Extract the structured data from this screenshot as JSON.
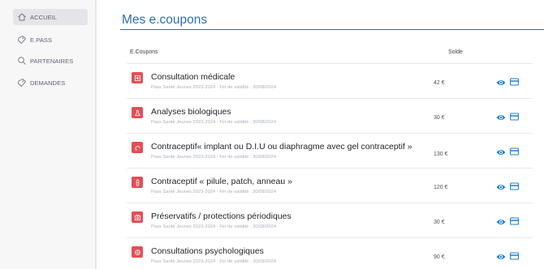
{
  "sidebar": {
    "items": [
      {
        "label": "ACCUEIL",
        "icon": "home-icon",
        "active": true
      },
      {
        "label": "E.PASS",
        "icon": "ticket-icon",
        "active": false
      },
      {
        "label": "PARTENAIRES",
        "icon": "search-icon",
        "active": false
      },
      {
        "label": "DEMANDES",
        "icon": "ticket-icon",
        "active": false
      }
    ]
  },
  "main": {
    "title": "Mes e.coupons",
    "columns": {
      "coupons": "E.Coupons",
      "solde": "Solde"
    },
    "rows": [
      {
        "name": "Consultation médicale",
        "sub": "Pass Santé Jeunes 2023-2024 - Fin de validité : 30/08/2024",
        "solde": "42 €",
        "icon": "medical-cross-icon"
      },
      {
        "name": "Analyses biologiques",
        "sub": "Pass Santé Jeunes 2023-2024 - Fin de validité : 30/08/2024",
        "solde": "30 €",
        "icon": "flask-icon"
      },
      {
        "name": "Contraceptif« implant ou D.I.U ou diaphragme avec gel contraceptif »",
        "sub": "Pass Santé Jeunes 2023-2024 - Fin de validité : 30/08/2024",
        "solde": "130 €",
        "icon": "implant-icon"
      },
      {
        "name": "Contraceptif « pilule, patch, anneau »",
        "sub": "Pass Santé Jeunes 2023-2024 - Fin de validité : 30/08/2024",
        "solde": "120 €",
        "icon": "pill-icon"
      },
      {
        "name": "Préservatifs / protections périodiques",
        "sub": "Pass Santé Jeunes 2023-2024 - Fin de validité : 30/08/2024",
        "solde": "30 €",
        "icon": "package-icon"
      },
      {
        "name": "Consultations psychologiques",
        "sub": "Pass Santé Jeunes 2023-2024 - Fin de validité : 30/08/2024",
        "solde": "90 €",
        "icon": "brain-icon"
      }
    ]
  },
  "colors": {
    "accent": "#2d6fb3",
    "badge": "#e54e55",
    "action_icon": "#1e7fd6"
  }
}
